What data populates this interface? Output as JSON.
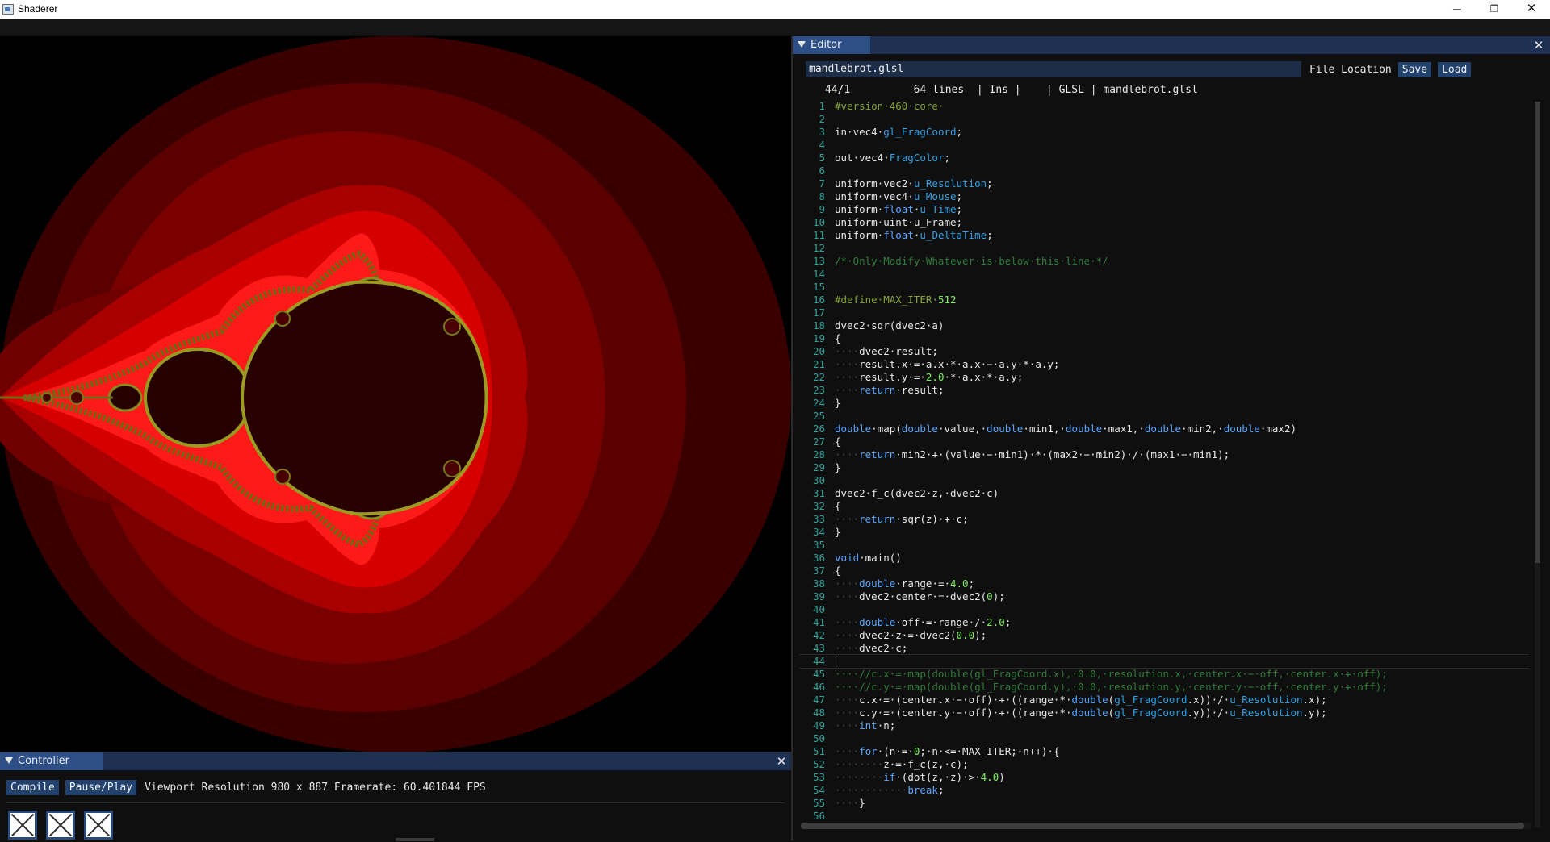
{
  "window": {
    "title": "Shaderer",
    "minimize_glyph": "─",
    "maximize_glyph": "❐",
    "close_glyph": "✕"
  },
  "viewport": {
    "description_colors": {
      "background": "#000000",
      "fractal_inner": "#2a0000",
      "glow": "#ff1a1a"
    }
  },
  "controller": {
    "title": "Controller",
    "close_glyph": "✕",
    "compile_label": "Compile",
    "pause_play_label": "Pause/Play",
    "info": "Viewport Resolution 980 x 887 Framerate: 60.401844 FPS",
    "textures": [
      "texture-slot-1",
      "texture-slot-2",
      "texture-slot-3"
    ]
  },
  "editor": {
    "title": "Editor",
    "close_glyph": "✕",
    "filename": "mandlebrot.glsl",
    "file_location_label": "File Location",
    "save_label": "Save",
    "load_label": "Load",
    "status": "44/1          64 lines  | Ins |    | GLSL | mandlebrot.glsl",
    "lines": [
      [
        [
          "pre",
          "#version·460·core·"
        ]
      ],
      [],
      [
        [
          "id",
          "in·vec4·"
        ],
        [
          "u",
          "gl_FragCoord"
        ],
        [
          "id",
          ";"
        ]
      ],
      [],
      [
        [
          "id",
          "out·vec4·"
        ],
        [
          "u",
          "FragColor"
        ],
        [
          "id",
          ";"
        ]
      ],
      [],
      [
        [
          "id",
          "uniform·vec2·"
        ],
        [
          "u",
          "u_Resolution"
        ],
        [
          "id",
          ";"
        ]
      ],
      [
        [
          "id",
          "uniform·vec4·"
        ],
        [
          "u",
          "u_Mouse"
        ],
        [
          "id",
          ";"
        ]
      ],
      [
        [
          "id",
          "uniform·"
        ],
        [
          "kw",
          "float"
        ],
        [
          "id",
          "·"
        ],
        [
          "u",
          "u_Time"
        ],
        [
          "id",
          ";"
        ]
      ],
      [
        [
          "id",
          "uniform·uint·u_Frame;"
        ]
      ],
      [
        [
          "id",
          "uniform·"
        ],
        [
          "kw",
          "float"
        ],
        [
          "id",
          "·"
        ],
        [
          "u",
          "u_DeltaTime"
        ],
        [
          "id",
          ";"
        ]
      ],
      [],
      [
        [
          "cm",
          "/*·Only·Modify·Whatever·is·below·this·line·*/"
        ]
      ],
      [],
      [],
      [
        [
          "pre",
          "#define·MAX_ITER·"
        ],
        [
          "num",
          "512"
        ]
      ],
      [],
      [
        [
          "id",
          "dvec2·sqr(dvec2·a)"
        ]
      ],
      [
        [
          "id",
          "{"
        ]
      ],
      [
        [
          "ws",
          "····"
        ],
        [
          "id",
          "dvec2·result;"
        ]
      ],
      [
        [
          "ws",
          "····"
        ],
        [
          "id",
          "result.x·=·a.x·*·a.x·−·a.y·*·a.y;"
        ]
      ],
      [
        [
          "ws",
          "····"
        ],
        [
          "id",
          "result.y·=·"
        ],
        [
          "num",
          "2.0"
        ],
        [
          "id",
          "·*·a.x·*·a.y;"
        ]
      ],
      [
        [
          "ws",
          "····"
        ],
        [
          "kw",
          "return"
        ],
        [
          "id",
          "·result;"
        ]
      ],
      [
        [
          "id",
          "}"
        ]
      ],
      [],
      [
        [
          "kw",
          "double"
        ],
        [
          "id",
          "·map("
        ],
        [
          "kw",
          "double"
        ],
        [
          "id",
          "·value,·"
        ],
        [
          "kw",
          "double"
        ],
        [
          "id",
          "·min1,·"
        ],
        [
          "kw",
          "double"
        ],
        [
          "id",
          "·max1,·"
        ],
        [
          "kw",
          "double"
        ],
        [
          "id",
          "·min2,·"
        ],
        [
          "kw",
          "double"
        ],
        [
          "id",
          "·max2)"
        ]
      ],
      [
        [
          "id",
          "{"
        ]
      ],
      [
        [
          "ws",
          "····"
        ],
        [
          "kw",
          "return"
        ],
        [
          "id",
          "·min2·+·(value·−·min1)·*·(max2·−·min2)·/·(max1·−·min1);"
        ]
      ],
      [
        [
          "id",
          "}"
        ]
      ],
      [],
      [
        [
          "id",
          "dvec2·f_c(dvec2·z,·dvec2·c)"
        ]
      ],
      [
        [
          "id",
          "{"
        ]
      ],
      [
        [
          "ws",
          "····"
        ],
        [
          "kw",
          "return"
        ],
        [
          "id",
          "·sqr(z)·+·c;"
        ]
      ],
      [
        [
          "id",
          "}"
        ]
      ],
      [],
      [
        [
          "kw",
          "void"
        ],
        [
          "id",
          "·main()"
        ]
      ],
      [
        [
          "id",
          "{"
        ]
      ],
      [
        [
          "ws",
          "····"
        ],
        [
          "kw",
          "double"
        ],
        [
          "id",
          "·range·=·"
        ],
        [
          "num",
          "4.0"
        ],
        [
          "id",
          ";"
        ]
      ],
      [
        [
          "ws",
          "····"
        ],
        [
          "id",
          "dvec2·center·=·dvec2("
        ],
        [
          "num",
          "0"
        ],
        [
          "id",
          ");"
        ]
      ],
      [],
      [
        [
          "ws",
          "····"
        ],
        [
          "kw",
          "double"
        ],
        [
          "id",
          "·off·=·range·/·"
        ],
        [
          "num",
          "2.0"
        ],
        [
          "id",
          ";"
        ]
      ],
      [
        [
          "ws",
          "····"
        ],
        [
          "id",
          "dvec2·z·=·dvec2("
        ],
        [
          "num",
          "0.0"
        ],
        [
          "id",
          ");"
        ]
      ],
      [
        [
          "ws",
          "····"
        ],
        [
          "id",
          "dvec2·c;"
        ]
      ],
      [],
      [
        [
          "cm",
          "····//c.x·=·map(double(gl_FragCoord.x),·0.0,·resolution.x,·center.x·−·off,·center.x·+·off);"
        ]
      ],
      [
        [
          "cm",
          "····//c.y·=·map(double(gl_FragCoord.y),·0.0,·resolution.y,·center.y·−·off,·center.y·+·off);"
        ]
      ],
      [
        [
          "ws",
          "····"
        ],
        [
          "id",
          "c.x·=·(center.x·−·off)·+·((range·*·"
        ],
        [
          "kw",
          "double"
        ],
        [
          "id",
          "("
        ],
        [
          "u",
          "gl_FragCoord"
        ],
        [
          "id",
          ".x))·/·"
        ],
        [
          "u",
          "u_Resolution"
        ],
        [
          "id",
          ".x);"
        ]
      ],
      [
        [
          "ws",
          "····"
        ],
        [
          "id",
          "c.y·=·(center.y·−·off)·+·((range·*·"
        ],
        [
          "kw",
          "double"
        ],
        [
          "id",
          "("
        ],
        [
          "u",
          "gl_FragCoord"
        ],
        [
          "id",
          ".y))·/·"
        ],
        [
          "u",
          "u_Resolution"
        ],
        [
          "id",
          ".y);"
        ]
      ],
      [
        [
          "ws",
          "····"
        ],
        [
          "kw",
          "int"
        ],
        [
          "id",
          "·n;"
        ]
      ],
      [],
      [
        [
          "ws",
          "····"
        ],
        [
          "kw",
          "for"
        ],
        [
          "id",
          "·(n·=·"
        ],
        [
          "num",
          "0"
        ],
        [
          "id",
          ";·n·<=·MAX_ITER;·n++)·{"
        ]
      ],
      [
        [
          "ws",
          "········"
        ],
        [
          "id",
          "z·=·f_c(z,·c);"
        ]
      ],
      [
        [
          "ws",
          "········"
        ],
        [
          "kw",
          "if"
        ],
        [
          "id",
          "·(dot(z,·z)·>·"
        ],
        [
          "num",
          "4.0"
        ],
        [
          "id",
          ")"
        ]
      ],
      [
        [
          "ws",
          "············"
        ],
        [
          "kw",
          "break"
        ],
        [
          "id",
          ";"
        ]
      ],
      [
        [
          "ws",
          "····"
        ],
        [
          "id",
          "}"
        ]
      ],
      []
    ]
  }
}
